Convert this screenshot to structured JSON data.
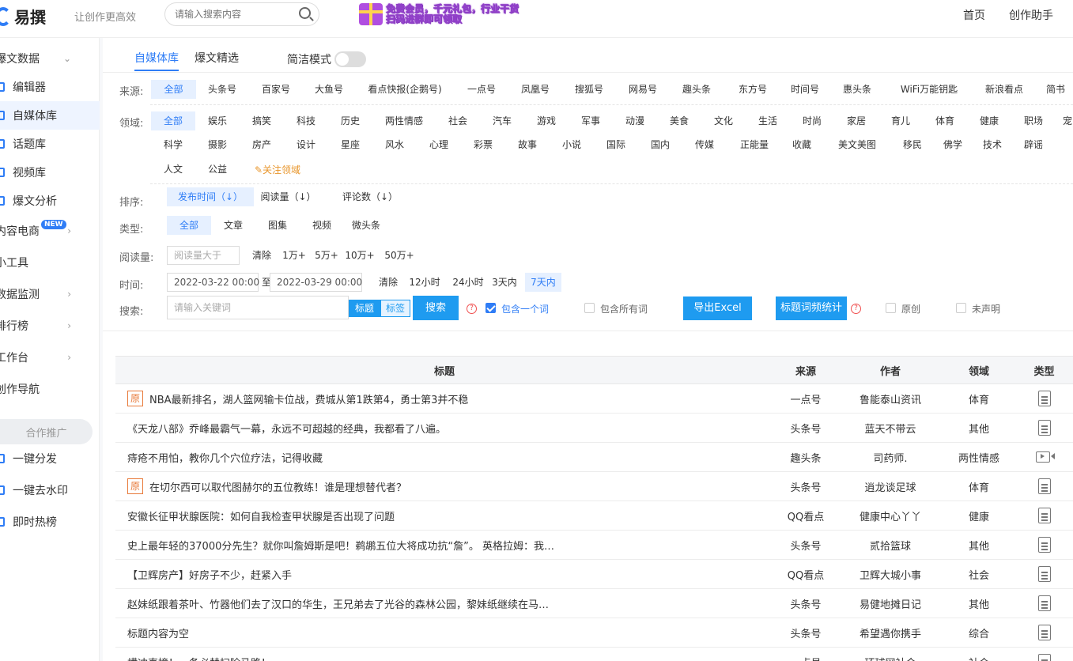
{
  "topbar": {
    "logo_text": "易撰",
    "slogan": "让创作更高效",
    "search_placeholder": "请输入搜索内容",
    "promo_line1": "免费会员，千元礼包，行业干货",
    "promo_line2": "扫码进群即可领取",
    "nav": [
      "首页",
      "创作助手"
    ]
  },
  "sidebar": {
    "items": [
      {
        "label": "爆文数据",
        "arrow": "⌄"
      },
      {
        "label": "编辑器"
      },
      {
        "label": "自媒体库",
        "selected": true
      },
      {
        "label": "话题库"
      },
      {
        "label": "视频库"
      },
      {
        "label": "爆文分析"
      },
      {
        "label": "内容电商",
        "badge": "NEW",
        "arrow": "›"
      },
      {
        "label": "小工具"
      },
      {
        "label": "数据监测",
        "arrow": "›"
      },
      {
        "label": "排行榜",
        "arrow": "›"
      },
      {
        "label": "工作台",
        "arrow": "›"
      },
      {
        "label": "创作导航"
      }
    ],
    "coop_label": "合作推广",
    "coop_items": [
      {
        "label": "一键分发"
      },
      {
        "label": "一键去水印"
      },
      {
        "label": "即时热榜"
      }
    ]
  },
  "tabs": [
    {
      "label": "自媒体库",
      "active": true
    },
    {
      "label": "爆文精选",
      "active": false
    }
  ],
  "mode_label": "简洁模式",
  "filters": {
    "source_label": "来源:",
    "sources": [
      "全部",
      "头条号",
      "百家号",
      "大鱼号",
      "看点快报(企鹅号)",
      "一点号",
      "凤凰号",
      "搜狐号",
      "网易号",
      "趣头条",
      "东方号",
      "时间号",
      "惠头条",
      "WiFi万能钥匙",
      "新浪看点",
      "简书"
    ],
    "domain_label": "领域:",
    "domains_row1": [
      "全部",
      "娱乐",
      "搞笑",
      "科技",
      "历史",
      "两性情感",
      "社会",
      "汽车",
      "游戏",
      "军事",
      "动漫",
      "美食",
      "文化",
      "生活",
      "时尚",
      "家居",
      "育儿",
      "体育",
      "健康",
      "职场",
      "宠"
    ],
    "domains_row2": [
      "科学",
      "摄影",
      "房产",
      "设计",
      "星座",
      "风水",
      "心理",
      "彩票",
      "故事",
      "小说",
      "国际",
      "国内",
      "传媒",
      "正能量",
      "收藏",
      "美文美图",
      "移民",
      "佛学",
      "技术",
      "辟谣"
    ],
    "domains_row3": [
      "人文",
      "公益"
    ],
    "follow_domain": "✎关注领域",
    "sort_label": "排序:",
    "sorts": [
      "发布时间（↓）",
      "阅读量（↓）",
      "评论数（↓）"
    ],
    "type_label": "类型:",
    "types": [
      "全部",
      "文章",
      "图集",
      "视频",
      "微头条"
    ],
    "reads_label": "阅读量:",
    "reads_placeholder": "阅读量大于",
    "reads_options": [
      "清除",
      "1万+",
      "5万+",
      "10万+",
      "50万+"
    ],
    "time_label": "时间:",
    "date_from": "2022-03-22 00:00",
    "date_to_sep": "至",
    "date_to": "2022-03-29 00:00",
    "time_options": [
      "清除",
      "12小时",
      "24小时",
      "3天内",
      "7天内"
    ],
    "search_label": "搜索:",
    "keyword_placeholder": "请输入关键词",
    "scope_title": "标题",
    "scope_tag": "标签",
    "search_btn": "搜索",
    "opt_any": "包含一个词",
    "opt_all": "包含所有词",
    "export_btn": "导出Excel",
    "freq_btn": "标题词频统计",
    "opt_original": "原创",
    "opt_undeclared": "未声明"
  },
  "table": {
    "headers": [
      "标题",
      "来源",
      "作者",
      "领域",
      "类型"
    ],
    "rows": [
      {
        "orig": "原",
        "title": "NBA最新排名，湖人篮网输卡位战，费城从第1跌第4，勇士第3并不稳",
        "source": "一点号",
        "author": "鲁能泰山资讯",
        "domain": "体育",
        "type": "article"
      },
      {
        "title": "《天龙八部》乔峰最霸气一幕，永远不可超越的经典，我都看了八遍。",
        "source": "头条号",
        "author": "蓝天不带云",
        "domain": "其他",
        "type": "article"
      },
      {
        "title": "痔疮不用怕，教你几个穴位疗法，记得收藏",
        "source": "趣头条",
        "author": "司药师.",
        "domain": "两性情感",
        "type": "video"
      },
      {
        "orig": "原",
        "title": "在切尔西可以取代图赫尔的五位教练！谁是理想替代者？",
        "source": "头条号",
        "author": "逍龙谈足球",
        "domain": "体育",
        "type": "article"
      },
      {
        "title": "安徽长征甲状腺医院：如何自我检查甲状腺是否出现了问题",
        "source": "QQ看点",
        "author": "健康中心丫丫",
        "domain": "健康",
        "type": "article"
      },
      {
        "title": "史上最年轻的37000分先生？就你叫詹姆斯是吧！鹈鹕五位大将成功抗“詹”。 英格拉姆：我…",
        "source": "头条号",
        "author": "贰拾篮球",
        "domain": "其他",
        "type": "article"
      },
      {
        "title": "【卫辉房产】好房子不少，赶紧入手",
        "source": "QQ看点",
        "author": "卫辉大城小事",
        "domain": "社会",
        "type": "article"
      },
      {
        "title": "赵妹纸跟着茶叶、竹器他们去了汉口的华生，王兄弟去了光谷的森林公园，黎妹纸继续在马…",
        "source": "头条号",
        "author": "易健地摊日记",
        "domain": "其他",
        "type": "article"
      },
      {
        "title": "标题内容为空",
        "source": "头条号",
        "author": "希望遇你携手",
        "domain": "综合",
        "type": "article"
      },
      {
        "title": "横冲直撞！一备必替扫除马路！",
        "source": "一点号",
        "author": "环球网社会",
        "domain": "社会",
        "type": "article"
      }
    ]
  }
}
